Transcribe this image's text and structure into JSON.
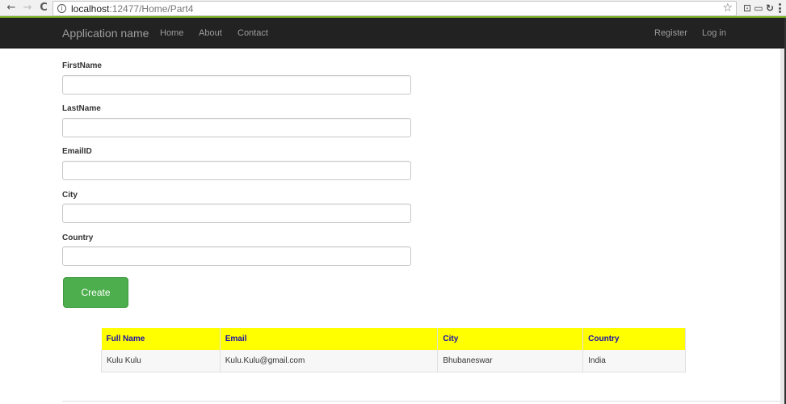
{
  "browser": {
    "url_host": "localhost",
    "url_path": ":12477/Home/Part4",
    "back_glyph": "←",
    "forward_glyph": "→",
    "reload_glyph": "C",
    "info_glyph": "i",
    "star_glyph": "☆",
    "ext1_glyph": "⊡",
    "ext2_glyph": "▭",
    "ext3_glyph": "↻"
  },
  "navbar": {
    "brand": "Application name",
    "links": [
      "Home",
      "About",
      "Contact"
    ],
    "right_links": [
      "Register",
      "Log in"
    ]
  },
  "form": {
    "fields": [
      {
        "label": "FirstName",
        "value": ""
      },
      {
        "label": "LastName",
        "value": ""
      },
      {
        "label": "EmailID",
        "value": ""
      },
      {
        "label": "City",
        "value": ""
      },
      {
        "label": "Country",
        "value": ""
      }
    ],
    "submit_label": "Create"
  },
  "table": {
    "headers": [
      "Full Name",
      "Email",
      "City",
      "Country"
    ],
    "rows": [
      [
        "Kulu Kulu",
        "Kulu.Kulu@gmail.com",
        "Bhubaneswar",
        "India"
      ]
    ]
  },
  "colors": {
    "navbar_bg": "#222222",
    "header_bg": "#ffff00",
    "header_text": "#1a0dab",
    "button_bg": "#4cae4c",
    "chrome_accent": "#7fb52a"
  }
}
